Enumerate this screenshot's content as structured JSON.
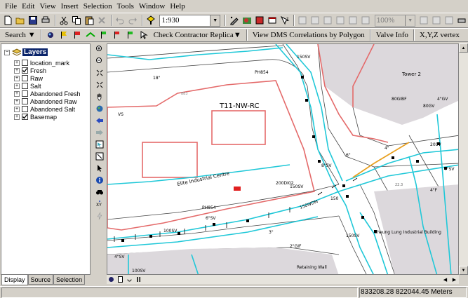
{
  "menu": [
    "File",
    "Edit",
    "View",
    "Insert",
    "Selection",
    "Tools",
    "Window",
    "Help"
  ],
  "toolbar": {
    "scale": "1:930",
    "zoom": "100%",
    "icons": [
      "new-icon",
      "open-icon",
      "save-icon",
      "print-icon",
      "cut-icon",
      "copy-icon",
      "paste-icon",
      "delete-icon",
      "undo-icon",
      "redo-icon",
      "add-data-icon"
    ],
    "icons_right": [
      "editor-icon",
      "arcmap-icon",
      "arccatalog-icon",
      "toolbox-icon",
      "whats-this-icon"
    ]
  },
  "toolbar2": {
    "search_label": "Search",
    "check_contractor": "Check Contractor Replica",
    "view_dms": "View DMS Correlations by Polygon",
    "valve_info": "Valve Info",
    "xyz_vertex": "X,Y,Z vertex"
  },
  "toc": {
    "root": "Layers",
    "layers": [
      {
        "name": "location_mark",
        "checked": false
      },
      {
        "name": "Fresh",
        "checked": true
      },
      {
        "name": "Raw",
        "checked": false
      },
      {
        "name": "Salt",
        "checked": false
      },
      {
        "name": "Abandoned Fresh",
        "checked": false
      },
      {
        "name": "Abandoned Raw",
        "checked": false
      },
      {
        "name": "Abandoned Salt",
        "checked": false
      },
      {
        "name": "Basemap",
        "checked": true
      }
    ],
    "tabs": [
      "Display",
      "Source",
      "Selection"
    ]
  },
  "map": {
    "building_label": "T11-NW-RC",
    "centre_label": "Elite Industrial Centre",
    "tower_label": "Tower 2",
    "cheung_label": "Cheung Lung Industrial Building",
    "wall_label": "Retaining Wall",
    "labels": [
      "PH854",
      "150SV",
      "18\"",
      "VS",
      "883",
      "4\"",
      "6\"",
      "150WDM",
      "200DI02",
      "PH854",
      "100SV",
      "150SV",
      "4\"SV",
      "6\"SV",
      "2\"GIF",
      "3\"",
      "80GIBF",
      "80GV",
      "20SV",
      "4\"GV",
      "150",
      "8\"SV",
      "4\"F",
      "4\"SV",
      "100SV",
      "150SV",
      "22.3"
    ]
  },
  "status": {
    "coords": "833208.28  822044.45 Meters"
  }
}
